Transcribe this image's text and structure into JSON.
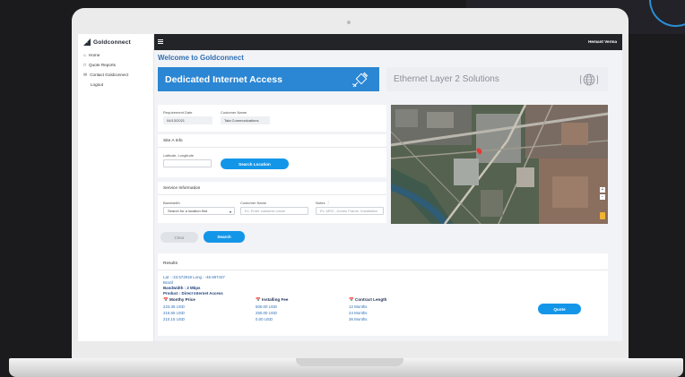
{
  "app": {
    "brand": "Goldconnect",
    "user_name": "Hemant Verma",
    "welcome": "Welcome to Goldconnect"
  },
  "sidebar": {
    "items": [
      {
        "label": "Home",
        "icon": "home-icon"
      },
      {
        "label": "Quote Reports",
        "icon": "document-icon"
      },
      {
        "label": "Contact Goldconnect",
        "icon": "mail-icon"
      },
      {
        "label": "Logout",
        "icon": ""
      }
    ]
  },
  "banners": {
    "dia": "Dedicated Internet Access",
    "ethernet": "Ethernet Layer 2 Solutions"
  },
  "request": {
    "date_label": "Requirement Date",
    "date_value": "04/13/2021",
    "customer_label": "Customer Name",
    "customer_value": "Tata Communications"
  },
  "site_a": {
    "title": "Site A Info",
    "latlong_label": "Latitude, Longitude",
    "latlong_value": "",
    "search_location": "Search Location"
  },
  "service": {
    "title": "Service Information",
    "bandwidth_label": "Bandwidth",
    "bandwidth_value": "Search for a location first",
    "customer_label": "Customer Name",
    "customer_placeholder": "Ex. Enter customer name",
    "notes_label": "Notes",
    "notes_placeholder": "Ex. MRC, Jumbo Frame, Installation"
  },
  "actions": {
    "clear": "Clear",
    "search": "Search"
  },
  "results": {
    "title": "Results",
    "latlong": "Lat : -23.572918 Long : -46.697437",
    "country": "Brazil",
    "bandwidth": "Bandwidth : 2 Mbps",
    "product": "Product : Direct Internet Access",
    "columns": [
      "Monthy Price",
      "Installing Fee",
      "Contract Length"
    ],
    "rows": [
      [
        "223.35 USD",
        "500.00 USD",
        "12 Months"
      ],
      [
        "216.65 USD",
        "250.00 USD",
        "24 Months"
      ],
      [
        "210.15 USD",
        "0.00 USD",
        "36 Months"
      ]
    ],
    "quote_button": "Quote"
  },
  "map": {
    "icons": [
      "map-pin-icon",
      "zoom-in-icon",
      "zoom-out-icon",
      "pegman-icon"
    ]
  },
  "colors": {
    "primary": "#1496e8",
    "banner_active": "#2b86d3",
    "topbar": "#222428",
    "heading": "#2f6fb4"
  }
}
